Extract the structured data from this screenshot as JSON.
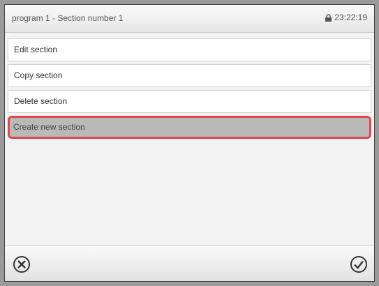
{
  "header": {
    "title": "program 1 - Section number 1",
    "time": "23:22:19",
    "lock_icon": "lock-icon"
  },
  "menu": {
    "items": [
      {
        "label": "Edit section",
        "selected": false
      },
      {
        "label": "Copy section",
        "selected": false
      },
      {
        "label": "Delete section",
        "selected": false
      },
      {
        "label": "Create new section",
        "selected": true
      }
    ]
  },
  "footer": {
    "cancel_icon": "close-circle-icon",
    "confirm_icon": "check-circle-icon"
  },
  "colors": {
    "highlight_border": "#e0474c",
    "selected_bg": "#b9b9b9"
  }
}
